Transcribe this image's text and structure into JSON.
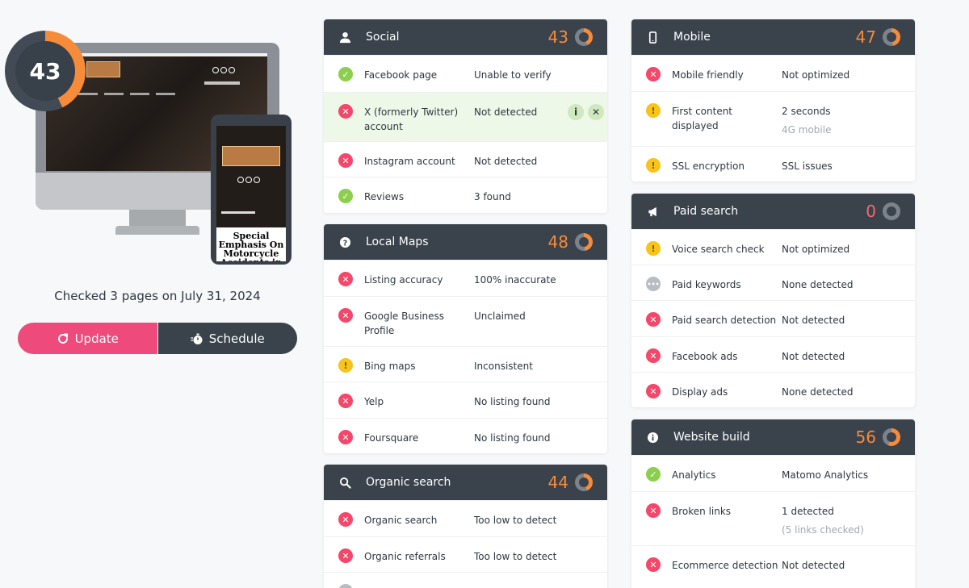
{
  "overall": {
    "score": "43",
    "checked_text": "Checked 3 pages on July 31, 2024",
    "update_label": "Update",
    "schedule_label": "Schedule"
  },
  "preview": {
    "site_text": "Special Emphasis On Motorcycle Accidents in"
  },
  "colors": {
    "ok": "#8ccf4f",
    "bad": "#f4476a",
    "warn": "#f8c31b",
    "na": "#b9bdc2",
    "accent": "#f68b3a",
    "pink": "#ef4a7c",
    "dark": "#3a424c"
  },
  "cards": {
    "social": {
      "title": "Social",
      "score": "43",
      "icon": "person-icon",
      "rows": [
        {
          "status": "ok",
          "label": "Facebook page",
          "value": "Unable to verify"
        },
        {
          "status": "bad",
          "label": "X (formerly Twitter) account",
          "value": "Not detected"
        },
        {
          "status": "bad",
          "label": "Instagram account",
          "value": "Not detected"
        },
        {
          "status": "ok",
          "label": "Reviews",
          "value": "3 found"
        }
      ]
    },
    "local_maps": {
      "title": "Local Maps",
      "score": "48",
      "icon": "question-icon",
      "rows": [
        {
          "status": "bad",
          "label": "Listing accuracy",
          "value": "100% inaccurate"
        },
        {
          "status": "bad",
          "label": "Google Business Profile",
          "value": "Unclaimed"
        },
        {
          "status": "warn",
          "label": "Bing maps",
          "value": "Inconsistent"
        },
        {
          "status": "bad",
          "label": "Yelp",
          "value": "No listing found"
        },
        {
          "status": "bad",
          "label": "Foursquare",
          "value": "No listing found"
        }
      ]
    },
    "organic": {
      "title": "Organic search",
      "score": "44",
      "icon": "search-icon",
      "rows": [
        {
          "status": "bad",
          "label": "Organic search",
          "value": "Too low to detect"
        },
        {
          "status": "bad",
          "label": "Organic referrals",
          "value": "Too low to detect"
        }
      ]
    },
    "mobile": {
      "title": "Mobile",
      "score": "47",
      "icon": "phone-icon",
      "rows": [
        {
          "status": "bad",
          "label": "Mobile friendly",
          "value": "Not optimized"
        },
        {
          "status": "warn",
          "label": "First content displayed",
          "value": "2 seconds",
          "sub": "4G mobile"
        },
        {
          "status": "warn",
          "label": "SSL encryption",
          "value": "SSL issues"
        }
      ]
    },
    "paid": {
      "title": "Paid search",
      "score": "0",
      "icon": "megaphone-icon",
      "rows": [
        {
          "status": "warn",
          "label": "Voice search check",
          "value": "Not optimized"
        },
        {
          "status": "na",
          "label": "Paid keywords",
          "value": "None detected"
        },
        {
          "status": "bad",
          "label": "Paid search detection",
          "value": "Not detected"
        },
        {
          "status": "bad",
          "label": "Facebook ads",
          "value": "Not detected"
        },
        {
          "status": "bad",
          "label": "Display ads",
          "value": "None detected"
        }
      ]
    },
    "website": {
      "title": "Website build",
      "score": "56",
      "icon": "info-icon",
      "rows": [
        {
          "status": "ok",
          "label": "Analytics",
          "value": "Matomo Analytics"
        },
        {
          "status": "bad",
          "label": "Broken links",
          "value": "1 detected",
          "sub": "(5 links checked)"
        },
        {
          "status": "bad",
          "label": "Ecommerce detection",
          "value": "Not detected"
        }
      ]
    }
  }
}
